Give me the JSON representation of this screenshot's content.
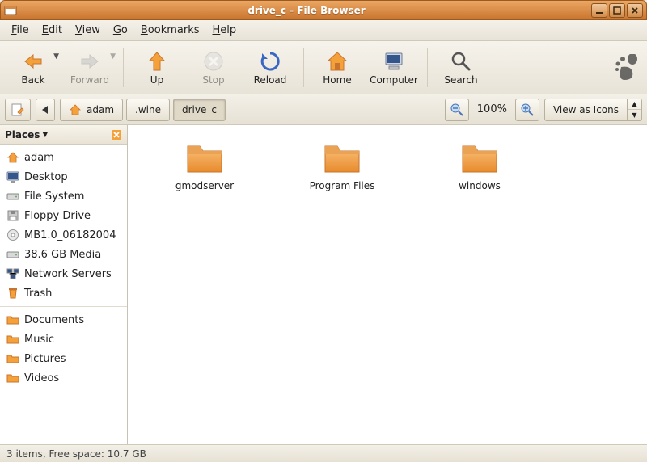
{
  "window": {
    "title": "drive_c - File Browser"
  },
  "menu": {
    "file": "File",
    "edit": "Edit",
    "view": "View",
    "go": "Go",
    "bookmarks": "Bookmarks",
    "help": "Help"
  },
  "toolbar": {
    "back": "Back",
    "forward": "Forward",
    "up": "Up",
    "stop": "Stop",
    "reload": "Reload",
    "home": "Home",
    "computer": "Computer",
    "search": "Search"
  },
  "location": {
    "crumbs": [
      {
        "label": "adam",
        "has_home_icon": true
      },
      {
        "label": ".wine"
      },
      {
        "label": "drive_c",
        "active": true
      }
    ],
    "zoom": "100%",
    "view_mode": "View as Icons"
  },
  "sidebar": {
    "title": "Places",
    "items_primary": [
      {
        "label": "adam",
        "icon": "home"
      },
      {
        "label": "Desktop",
        "icon": "desktop"
      },
      {
        "label": "File System",
        "icon": "drive"
      },
      {
        "label": "Floppy Drive",
        "icon": "floppy"
      },
      {
        "label": "MB1.0_06182004",
        "icon": "cd"
      },
      {
        "label": "38.6 GB Media",
        "icon": "drive"
      },
      {
        "label": "Network Servers",
        "icon": "network"
      },
      {
        "label": "Trash",
        "icon": "trash"
      }
    ],
    "items_bookmarks": [
      {
        "label": "Documents",
        "icon": "folder"
      },
      {
        "label": "Music",
        "icon": "folder"
      },
      {
        "label": "Pictures",
        "icon": "folder"
      },
      {
        "label": "Videos",
        "icon": "folder"
      }
    ]
  },
  "files": [
    {
      "name": "gmodserver",
      "type": "folder"
    },
    {
      "name": "Program Files",
      "type": "folder"
    },
    {
      "name": "windows",
      "type": "folder"
    }
  ],
  "status": {
    "text": "3 items, Free space: 10.7 GB"
  }
}
